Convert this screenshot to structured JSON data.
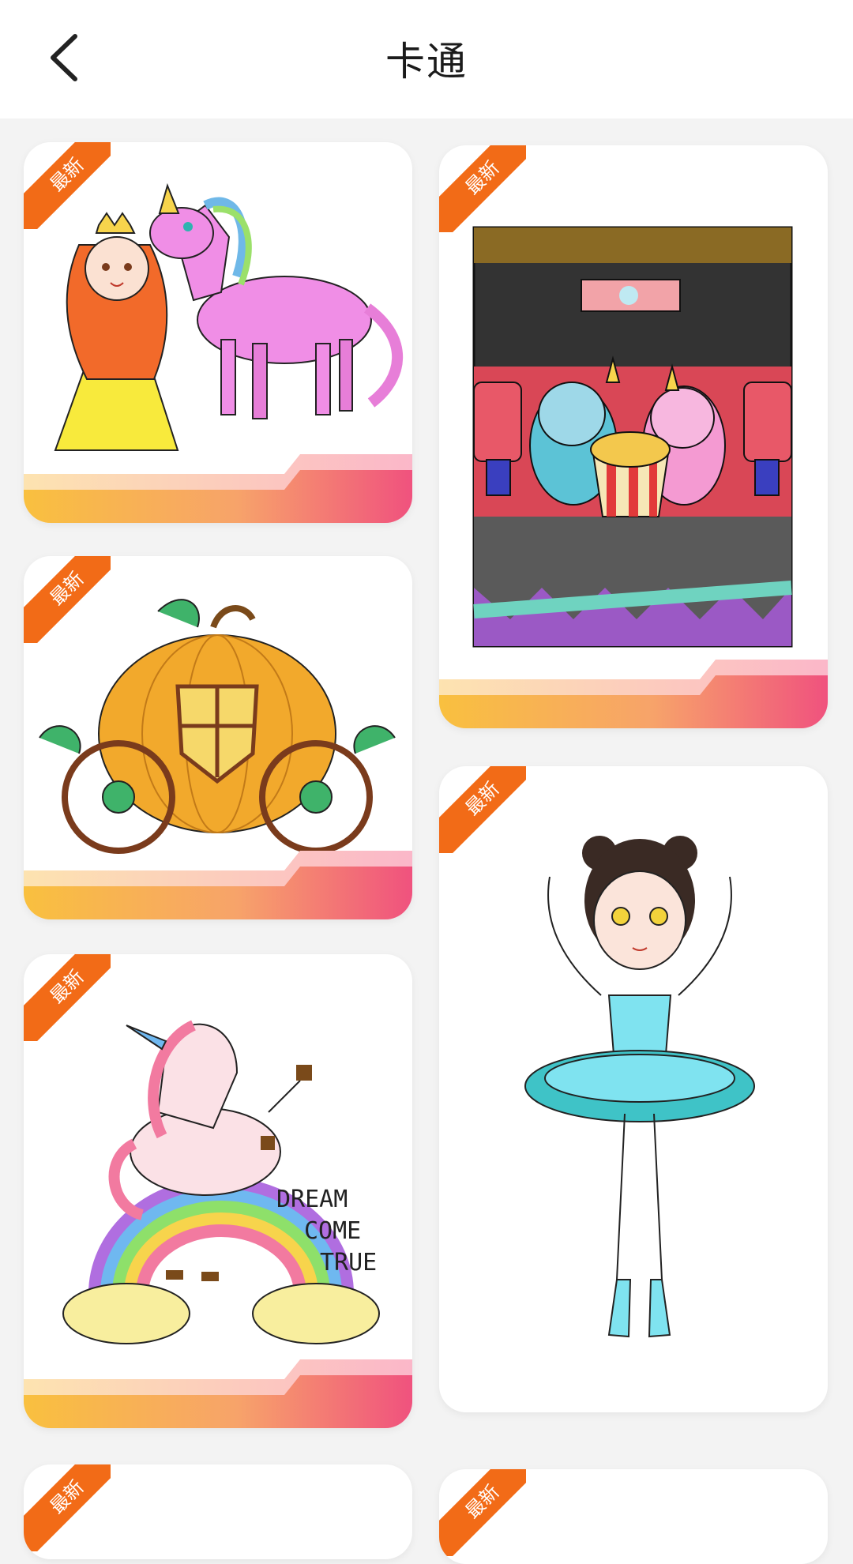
{
  "header": {
    "title": "卡通",
    "back_icon": "chevron-left-icon"
  },
  "cards": [
    {
      "badge": "最新",
      "subject": "princess-unicorn"
    },
    {
      "badge": "最新",
      "subject": "cinema-unicorns"
    },
    {
      "badge": "最新",
      "subject": "pumpkin-carriage"
    },
    {
      "badge": "最新",
      "subject": "ballerina"
    },
    {
      "badge": "最新",
      "subject": "unicorn-rainbow",
      "art_text": [
        "DREAM",
        "COME",
        "TRUE"
      ]
    },
    {
      "badge": "最新",
      "subject": "partial"
    },
    {
      "badge": "最新",
      "subject": "partial"
    }
  ],
  "colors": {
    "badge": "#f26b17",
    "band_start": "#f9c03f",
    "band_end": "#f0527e",
    "page_bg": "#f3f3f3"
  }
}
